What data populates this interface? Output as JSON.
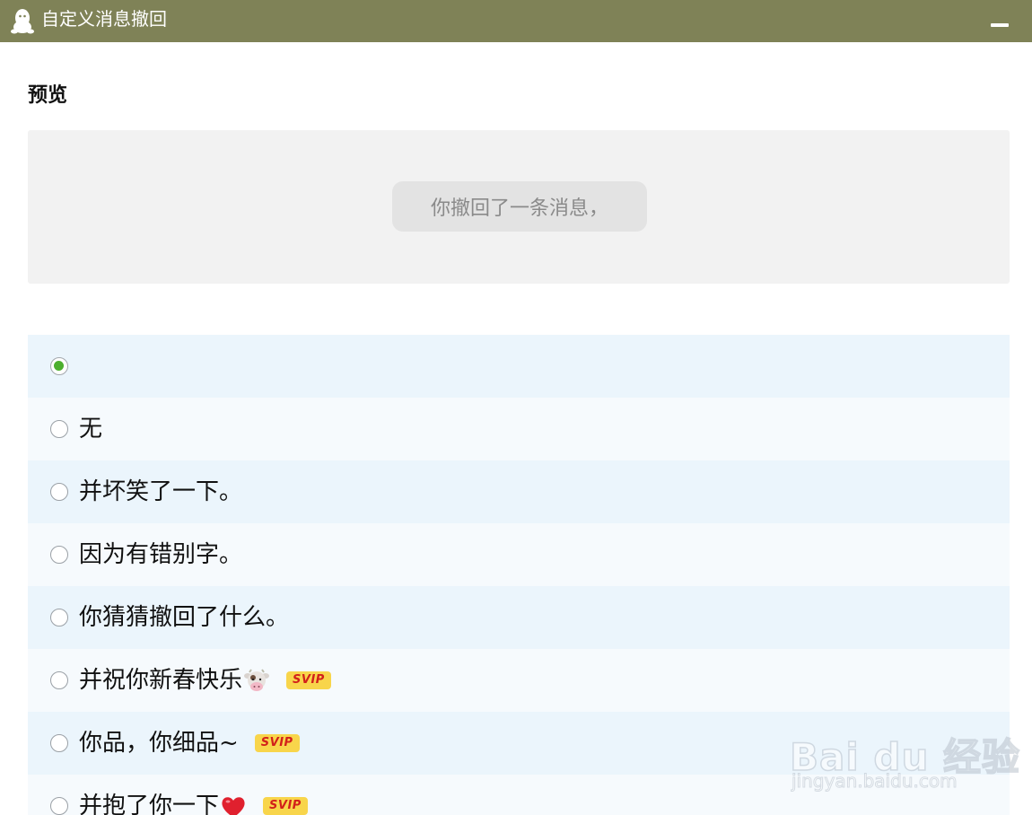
{
  "window": {
    "title": "自定义消息撤回",
    "app_icon": "qq-penguin-icon",
    "minimize_icon": "minimize-icon"
  },
  "preview": {
    "heading": "预览",
    "message": "你撤回了一条消息，"
  },
  "options": [
    {
      "label": "",
      "checked": true
    },
    {
      "label": "无",
      "checked": false
    },
    {
      "label": "并坏笑了一下。",
      "checked": false
    },
    {
      "label": "因为有错别字。",
      "checked": false
    },
    {
      "label": "你猜猜撤回了什么。",
      "checked": false
    },
    {
      "label": "并祝你新春快乐",
      "emoji": "cow-face",
      "badge": "SVIP",
      "checked": false
    },
    {
      "label": "你品，你细品~",
      "badge": "SVIP",
      "checked": false
    },
    {
      "label": "并抱了你一下",
      "emoji": "red-heart",
      "badge": "SVIP",
      "checked": false
    }
  ],
  "watermark": {
    "brand": "Bai du 经验",
    "url": "jingyan.baidu.com"
  },
  "colors": {
    "titlebar": "#7f8257",
    "row_alt": "#ebf5fc",
    "radio_checked": "#4caf2e",
    "badge_bg": "#f8d54b",
    "badge_text": "#d2201a"
  }
}
